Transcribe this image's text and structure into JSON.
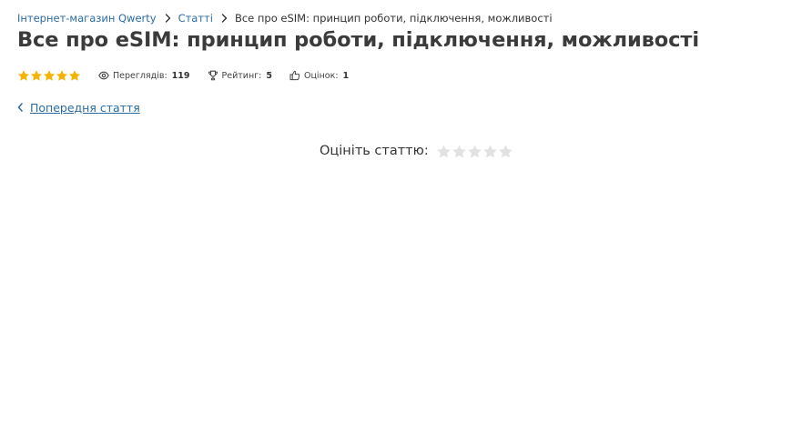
{
  "breadcrumb": {
    "home": "Інтернет-магазин Qwerty",
    "section": "Статті",
    "current": "Все про eSIM: принцип роботи, підключення, можливості"
  },
  "article": {
    "title": "Все про eSIM: принцип роботи, підключення, можливості"
  },
  "meta": {
    "star_rating": 5,
    "star_max": 5,
    "views_label": "Переглядів:",
    "views_value": "119",
    "rating_label": "Рейтинг:",
    "rating_value": "5",
    "votes_label": "Оцінок:",
    "votes_value": "1"
  },
  "nav": {
    "prev_label": "Попередня стаття"
  },
  "rate": {
    "label": "Оцініть статтю:",
    "stars_total": 5
  },
  "colors": {
    "link": "#2a6da6",
    "star_filled": "#f5b301",
    "star_empty": "#e2e2e2",
    "title": "#3b3b3b"
  },
  "icons": {
    "breadcrumb_separator": "chevron-right-icon",
    "views": "eye-icon",
    "rating": "trophy-icon",
    "votes": "thumbs-up-icon",
    "prev": "chevron-left-icon",
    "star": "star-icon"
  }
}
